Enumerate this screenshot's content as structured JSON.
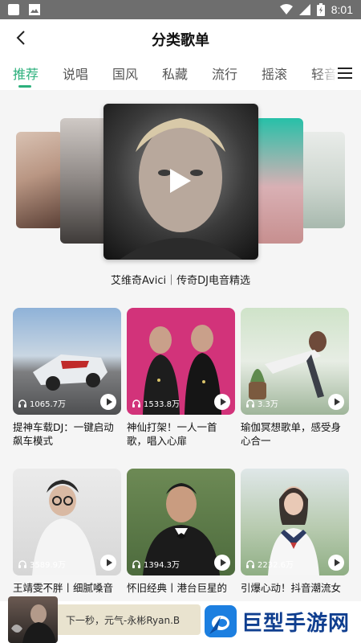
{
  "status_bar": {
    "time": "8:01"
  },
  "header": {
    "title": "分类歌单"
  },
  "tabs": [
    {
      "label": "推荐",
      "active": true
    },
    {
      "label": "说唱",
      "active": false
    },
    {
      "label": "国风",
      "active": false
    },
    {
      "label": "私藏",
      "active": false
    },
    {
      "label": "流行",
      "active": false
    },
    {
      "label": "摇滚",
      "active": false
    },
    {
      "label": "轻音",
      "active": false
    }
  ],
  "carousel": {
    "featured_caption": "艾维奇Avici｜传奇DJ电音精选"
  },
  "playlists": [
    {
      "title": "提神车载DJ：一键启动飙车模式",
      "plays": "1065.7万"
    },
    {
      "title": "神仙打架！一人一首歌，唱入心扉",
      "plays": "1533.8万"
    },
    {
      "title": "瑜伽冥想歌单，感受身心合一",
      "plays": "3.3万"
    },
    {
      "title": "王靖雯不胖丨细腻嗓音",
      "plays": "3589.9万"
    },
    {
      "title": "怀旧经典丨港台巨星的",
      "plays": "1394.3万"
    },
    {
      "title": "引爆心动！抖音潮流女",
      "plays": "2232.6万"
    }
  ],
  "player": {
    "now_playing": "下一秒，元气-永彬Ryan.B"
  },
  "watermark": {
    "text": "巨型手游网"
  },
  "colors": {
    "accent": "#2cb07c",
    "statusbar": "#6e6e6e"
  },
  "icons": {
    "back": "chevron-left-icon",
    "menu": "hamburger-menu-icon",
    "play": "play-icon",
    "headphones": "headphones-icon"
  }
}
